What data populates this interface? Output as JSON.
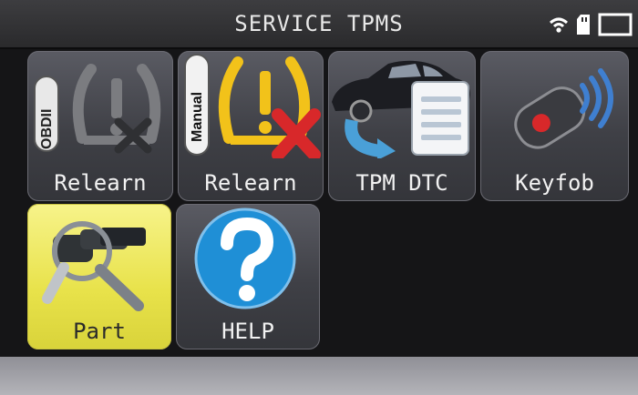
{
  "header": {
    "title": "SERVICE TPMS"
  },
  "status": {
    "icons": [
      "wifi-icon",
      "sd-card-icon",
      "battery-icon"
    ]
  },
  "tiles": [
    {
      "label": "Relearn",
      "badge": "OBDII",
      "icon": "tpms-warning-icon"
    },
    {
      "label": "Relearn",
      "badge": "Manual",
      "icon": "tpms-warning-icon"
    },
    {
      "label": "TPM DTC",
      "icon": "car-document-icon"
    },
    {
      "label": "Keyfob",
      "icon": "keyfob-icon"
    },
    {
      "label": "Part",
      "icon": "tpms-sensor-icon"
    },
    {
      "label": "HELP",
      "icon": "question-icon"
    }
  ],
  "colors": {
    "part_tile": "#e8e24a",
    "warning_yellow": "#f2c21a",
    "error_red": "#d8282a",
    "help_blue": "#1f8fd6"
  }
}
